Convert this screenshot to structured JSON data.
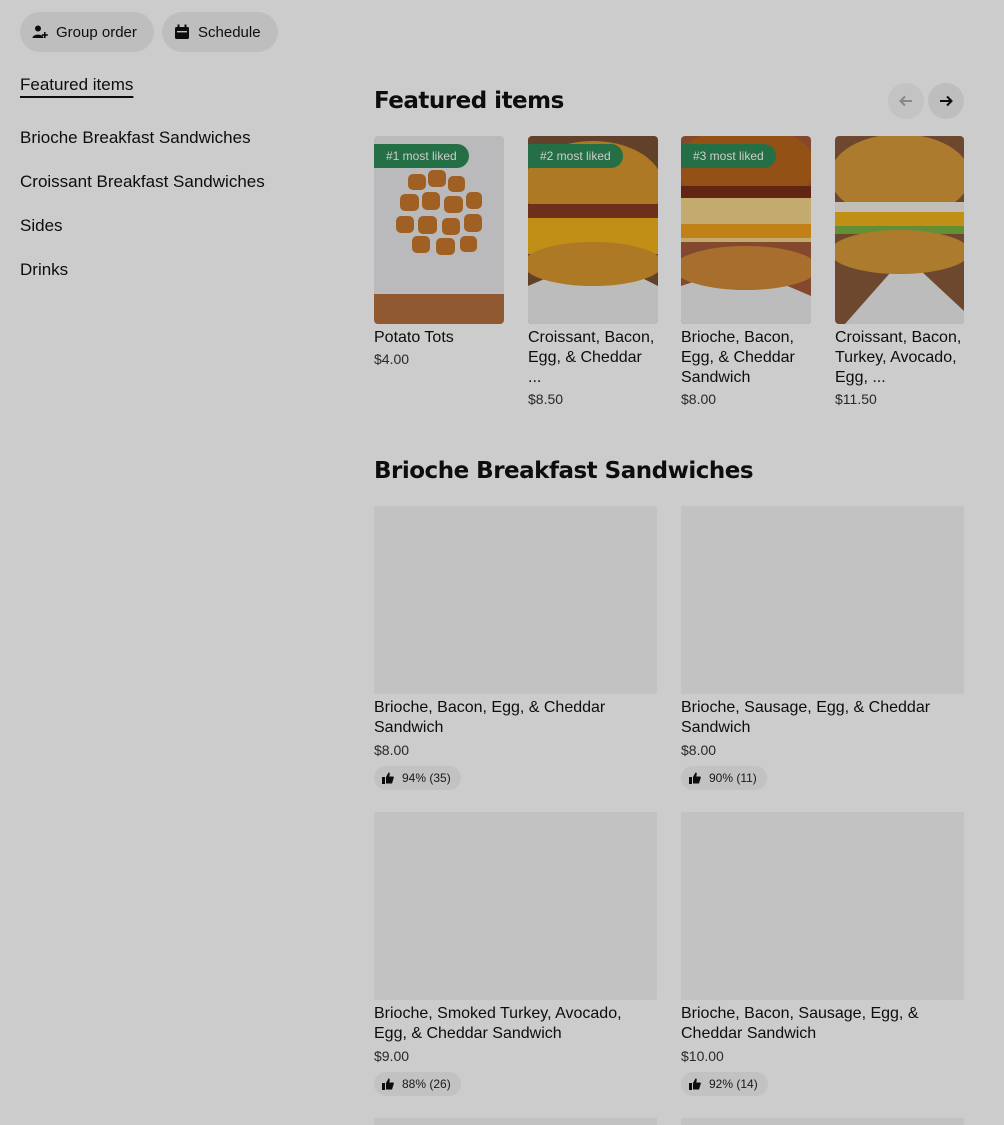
{
  "toolbar": {
    "group_order_label": "Group order",
    "schedule_label": "Schedule"
  },
  "sidebar": {
    "items": [
      {
        "label": "Featured items"
      },
      {
        "label": "Brioche Breakfast Sandwiches"
      },
      {
        "label": "Croissant Breakfast Sandwiches"
      },
      {
        "label": "Sides"
      },
      {
        "label": "Drinks"
      }
    ]
  },
  "featured": {
    "title": "Featured items",
    "items": [
      {
        "badge": "#1 most liked",
        "name": "Potato Tots",
        "price": "$4.00"
      },
      {
        "badge": "#2 most liked",
        "name": "Croissant, Bacon, Egg, & Cheddar ...",
        "price": "$8.50"
      },
      {
        "badge": "#3 most liked",
        "name": "Brioche, Bacon, Egg, & Cheddar Sandwich",
        "price": "$8.00"
      },
      {
        "badge": "",
        "name": "Croissant, Bacon, Turkey, Avocado, Egg, ...",
        "price": "$11.50"
      }
    ]
  },
  "brioche": {
    "title": "Brioche Breakfast Sandwiches",
    "items": [
      {
        "name": "Brioche, Bacon, Egg, & Cheddar Sandwich",
        "price": "$8.00",
        "rating": "94% (35)"
      },
      {
        "name": "Brioche, Sausage, Egg, & Cheddar Sandwich",
        "price": "$8.00",
        "rating": "90% (11)"
      },
      {
        "name": "Brioche, Smoked Turkey, Avocado, Egg, & Cheddar Sandwich",
        "price": "$9.00",
        "rating": "88% (26)"
      },
      {
        "name": "Brioche, Bacon, Sausage, Egg, & Cheddar Sandwich",
        "price": "$10.00",
        "rating": "92% (14)"
      }
    ]
  },
  "colors": {
    "badge_green": "#2e8b57",
    "pill_bg": "#eeeeee",
    "dim_overlay": "rgba(0,0,0,0.2)"
  }
}
